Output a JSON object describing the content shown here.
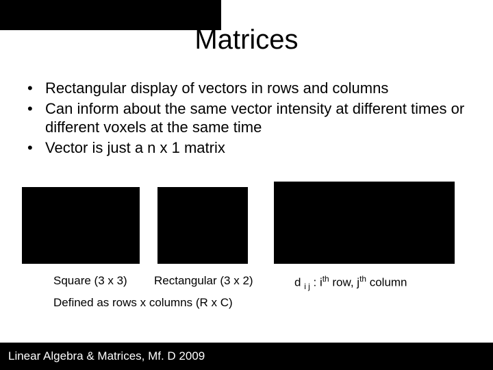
{
  "title": "Matrices",
  "bullets": {
    "b1": "Rectangular display of vectors in rows and columns",
    "b2": "Can inform about the same vector intensity at different times or different voxels at the same time",
    "b3": "Vector is just a n x 1 matrix"
  },
  "captions": {
    "square": "Square (3 x 3)",
    "rect": "Rectangular (3 x 2)",
    "dij_pre": "d ",
    "dij_sub": "i j",
    "dij_mid": " : i",
    "dij_th1": "th",
    "dij_row": " row, j",
    "dij_th2": "th",
    "dij_col": " column"
  },
  "defined": "Defined as rows x columns (R x C)",
  "footer": "Linear Algebra & Matrices, Mf. D 2009"
}
